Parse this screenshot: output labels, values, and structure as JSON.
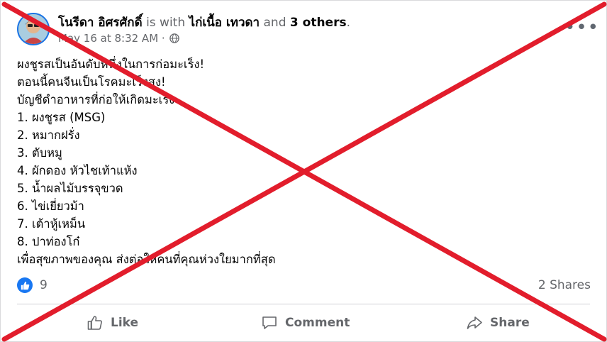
{
  "post": {
    "author": "โนรีดา อิศรศักดิ์",
    "with_text": "is with",
    "tagged": "ไก่เนื้อ เทวดา",
    "and_text": "and",
    "others": "3 others",
    "period": ".",
    "timestamp": "May 16 at 8:32 AM ·",
    "privacy_icon": "globe-icon",
    "lines": [
      "ผงชูรสเป็นอันดับหนึ่งในการก่อมะเร็ง!",
      "ตอนนี้คนจีนเป็นโรคมะเร็งสูง!",
      "บัญชีดำอาหารที่ก่อให้เกิดมะเร็ง",
      "1. ผงชูรส (MSG)",
      "2. หมากฝรั่ง",
      "3. ตับหมู",
      "4. ผักดอง หัวไชเท้าแห้ง",
      "5. น้ำผลไม้บรรจุขวด",
      "6. ไข่เยี่ยวม้า",
      "7. เต้าหู้เหม็น",
      "8. ปาท่องโก๋",
      "เพื่อสุขภาพของคุณ ส่งต่อให้คนที่คุณห่วงใยมากที่สุด"
    ]
  },
  "reactions": {
    "count": "9",
    "shares": "2 Shares"
  },
  "actions": {
    "like": "Like",
    "comment": "Comment",
    "share": "Share"
  },
  "colors": {
    "overlay_x": "#e21d2c",
    "facebook_blue": "#1877f2"
  }
}
